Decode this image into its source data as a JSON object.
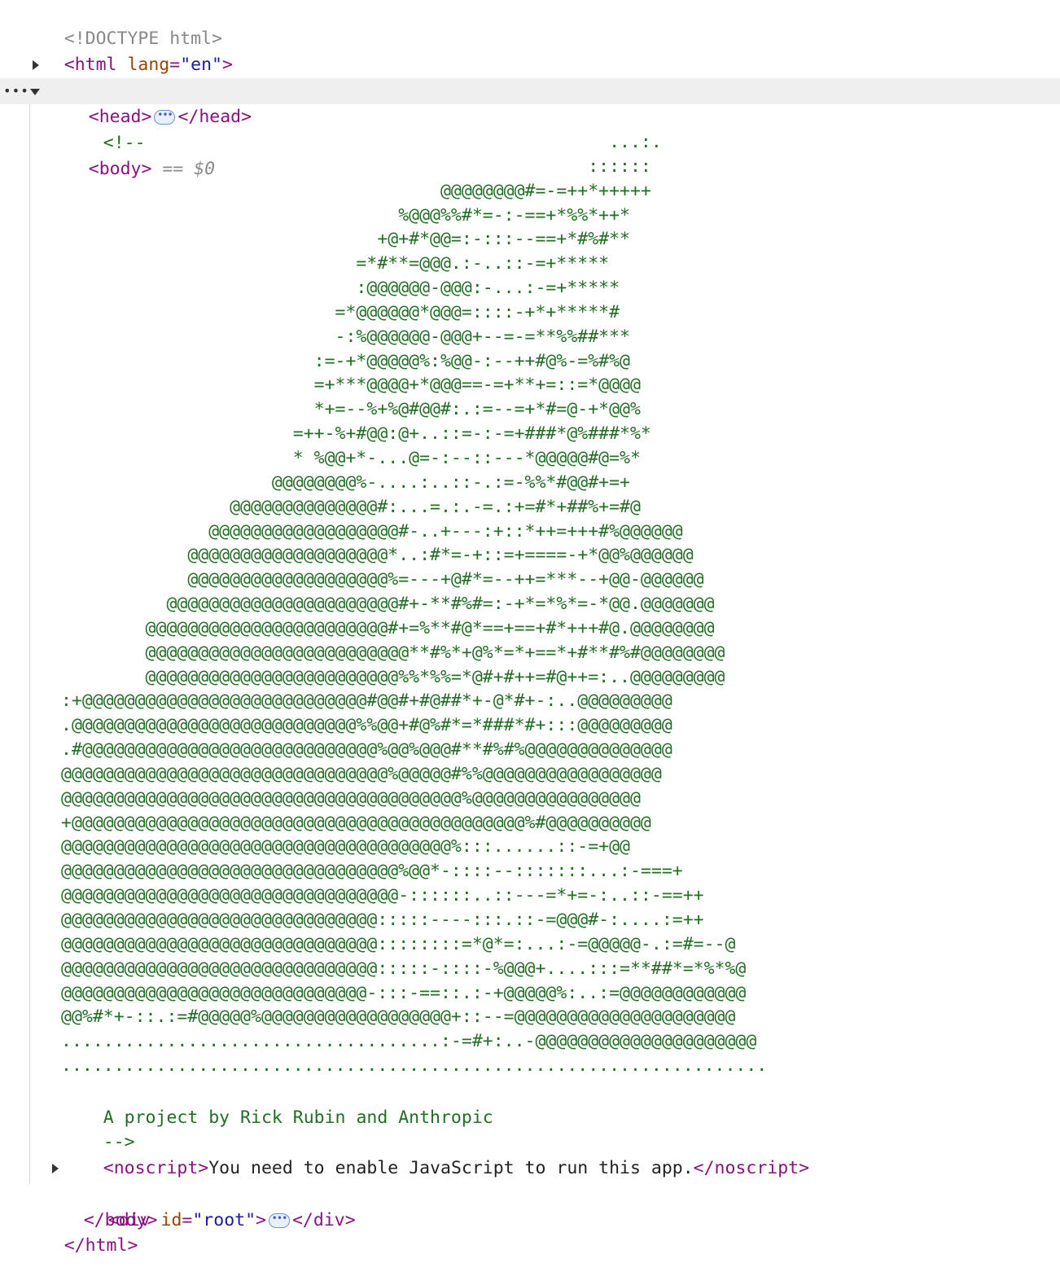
{
  "doctype": "<!DOCTYPE html>",
  "html_open": {
    "tag": "<html",
    "attr": "lang",
    "value": "\"en\"",
    "close": ">"
  },
  "head": {
    "open": "<head>",
    "ellipsis": "•••",
    "close": "</head>"
  },
  "body": {
    "gutter": "•••",
    "open": "<body>",
    "marker": "== $0",
    "close": "</body>"
  },
  "comment": {
    "open": "<!--",
    "art": "                                                    ...:.\n                                                  ::::::\n                                    @@@@@@@@#=-=++*+++++\n                                %@@@%%#*=-:-==+*%%*++*\n                              +@+#*@@=:-:::--==+*#%#**\n                            =*#**=@@@.:-..::-=+*****\n                            :@@@@@@-@@@:-...:-=+*****\n                          =*@@@@@@*@@@=::::-+*+*****#\n                          -:%@@@@@@-@@@+--=-=**%%##***\n                        :=-+*@@@@@%:%@@-:--++#@%-=%#%@\n                        =+***@@@@+*@@@==-=+**+=::=*@@@@\n                        *+=--%+%@#@@#:.:=--=+*#=@-+*@@%\n                      =++-%+#@@:@+..::=-:-=+###*@%###*%*\n                      * %@@+*-...@=-:--::---*@@@@@#@=%*\n                    @@@@@@@@%-....:..::-.:=-%%*#@@#+=+\n                @@@@@@@@@@@@@@#:...=.:.-=.:+=#*+##%+=#@\n              @@@@@@@@@@@@@@@@@@#-..+---:+::*++=+++#%@@@@@@\n            @@@@@@@@@@@@@@@@@@@*..:#*=-+::=+====-+*@@%@@@@@@\n            @@@@@@@@@@@@@@@@@@@%=---+@#*=--++=***--+@@-@@@@@@\n          @@@@@@@@@@@@@@@@@@@@@@#+-**#%#=:-+*=*%*=-*@@.@@@@@@@\n        @@@@@@@@@@@@@@@@@@@@@@@#+=%**#@*==+==+#*+++#@.@@@@@@@@\n        @@@@@@@@@@@@@@@@@@@@@@@@@**#%*+@%*=*+==*+#**#%#@@@@@@@@\n        @@@@@@@@@@@@@@@@@@@@@@@@%%*%%=*@#+#++=#@++=:..@@@@@@@@@\n:+@@@@@@@@@@@@@@@@@@@@@@@@@@@#@@#+#@##*+-@*#+-:..@@@@@@@@@\n.@@@@@@@@@@@@@@@@@@@@@@@@@@@%%@@+#@%#*=*###*#+:::@@@@@@@@@\n.#@@@@@@@@@@@@@@@@@@@@@@@@@@@@%@@%@@@#**#%#%@@@@@@@@@@@@@@\n@@@@@@@@@@@@@@@@@@@@@@@@@@@@@@@%@@@@@#%%@@@@@@@@@@@@@@@@@\n@@@@@@@@@@@@@@@@@@@@@@@@@@@@@@@@@@@@@@%@@@@@@@@@@@@@@@@\n+@@@@@@@@@@@@@@@@@@@@@@@@@@@@@@@@@@@@@@@@@@@%#@@@@@@@@@@\n@@@@@@@@@@@@@@@@@@@@@@@@@@@@@@@@@@@@@%:::......::-=+@@\n@@@@@@@@@@@@@@@@@@@@@@@@@@@@@@@@%@@*-::::--:::::::...:-===+\n@@@@@@@@@@@@@@@@@@@@@@@@@@@@@@@@-::::::..::---=*+=-:..::-==++\n@@@@@@@@@@@@@@@@@@@@@@@@@@@@@@:::::----:::.::-=@@@#-:....:=++\n@@@@@@@@@@@@@@@@@@@@@@@@@@@@@@::::::::=*@*=:...:-=@@@@@-.:=#=--@\n@@@@@@@@@@@@@@@@@@@@@@@@@@@@@@:::::-::::-%@@@+....:::=**##*=*%*%@\n@@@@@@@@@@@@@@@@@@@@@@@@@@@@@-:::-==::.:-+@@@@@%:..:=@@@@@@@@@@@@\n@@%#*+-::.:=#@@@@@%@@@@@@@@@@@@@@@@@@+::--=@@@@@@@@@@@@@@@@@@@@@\n....................................:-=#+:..-@@@@@@@@@@@@@@@@@@@@@\n...................................................................",
    "credit": "A project by Rick Rubin and Anthropic",
    "close": "-->"
  },
  "noscript": {
    "open": "<noscript>",
    "text": "You need to enable JavaScript to run this app.",
    "close": "</noscript>"
  },
  "root_div": {
    "open": "<div",
    "attr": "id",
    "value": "\"root\"",
    "gt": ">",
    "ellipsis": "•••",
    "close": "</div>"
  },
  "html_close": "</html>"
}
